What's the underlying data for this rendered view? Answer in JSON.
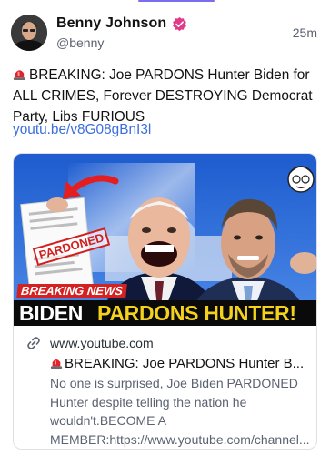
{
  "post": {
    "author": {
      "display_name": "Benny Johnson",
      "handle": "@benny",
      "verified": true,
      "verified_icon": "verified-badge-icon",
      "avatar_icon": "avatar"
    },
    "timestamp": "25m",
    "text": "BREAKING: Joe PARDONS Hunter Biden for ALL CRIMES, Forever DESTROYING Democrat Party, Libs FURIOUS",
    "text_prefix_icon": "siren-icon",
    "link_text": "youtu.be/v8G08gBnI3l"
  },
  "link_card": {
    "thumbnail": {
      "stamp_text": "PARDONED",
      "tag_text": "BREAKING NEWS",
      "headline_white": "BIDEN",
      "headline_yellow": "PARDONS HUNTER!"
    },
    "domain": "www.youtube.com",
    "domain_icon": "link-icon",
    "title": "BREAKING: Joe PARDONS Hunter B...",
    "description": "No one is surprised, Joe Biden PARDONED Hunter despite telling the nation he wouldn't.BECOME A MEMBER:https://www.youtube.com/channel..."
  },
  "colors": {
    "accent_bar": "#7c6cf0",
    "link": "#3b6fdd",
    "verified": "#e23a8a",
    "tag_red": "#d42222",
    "headline_yellow": "#f4d21c"
  }
}
